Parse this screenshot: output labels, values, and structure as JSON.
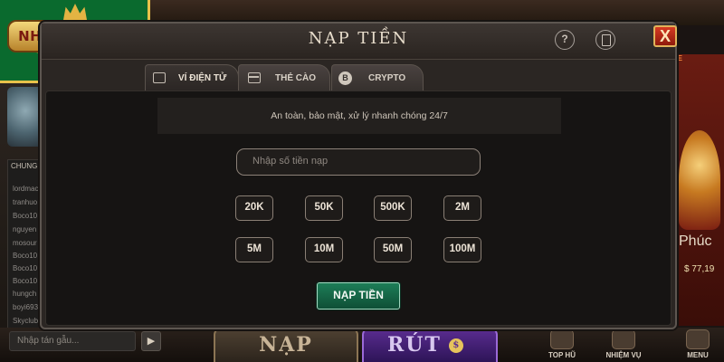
{
  "logo": {
    "text": "NHACAIUYTIN"
  },
  "modal": {
    "title": "NẠP TIỀN",
    "help_label": "?",
    "close_label": "X"
  },
  "tabs": [
    {
      "label": "VÍ ĐIỆN TỬ",
      "icon": "wallet-icon"
    },
    {
      "label": "THẺ CÀO",
      "icon": "card-icon"
    },
    {
      "label": "CRYPTO",
      "icon": "bitcoin-icon",
      "icon_glyph": "B"
    }
  ],
  "notice": "An toàn, bảo mật, xử lý nhanh chóng 24/7",
  "amount_input": {
    "placeholder": "Nhập số tiền nạp"
  },
  "amounts": [
    "20K",
    "50K",
    "500K",
    "2M",
    "5M",
    "10M",
    "50M",
    "100M"
  ],
  "submit_label": "NẠP TIỀN",
  "background": {
    "chat_title": "CHUNG",
    "chat_users": [
      "lordmac",
      "tranhuo",
      "Boco10",
      "nguyen",
      "mosour",
      "Boco10",
      "Boco10",
      "Boco10",
      "hungch",
      "boyi693",
      "Skyclub"
    ],
    "chat_placeholder": "Nhập tán gẫu...",
    "chat_send": "▶",
    "nap_button": "NẠP",
    "rut_button": "RÚT",
    "rut_coin": "$",
    "right_tag": "ME",
    "right_brand": "Phúc",
    "right_price": "$ 77,19",
    "nav_labels": [
      "TOP HŨ",
      "NHIỆM VỤ",
      "MENU"
    ]
  },
  "colors": {
    "modal_bg": "#2b2623",
    "accent_green": "#1d7d57",
    "logo_green": "#0a6a2e",
    "close_red": "#d63a22"
  }
}
